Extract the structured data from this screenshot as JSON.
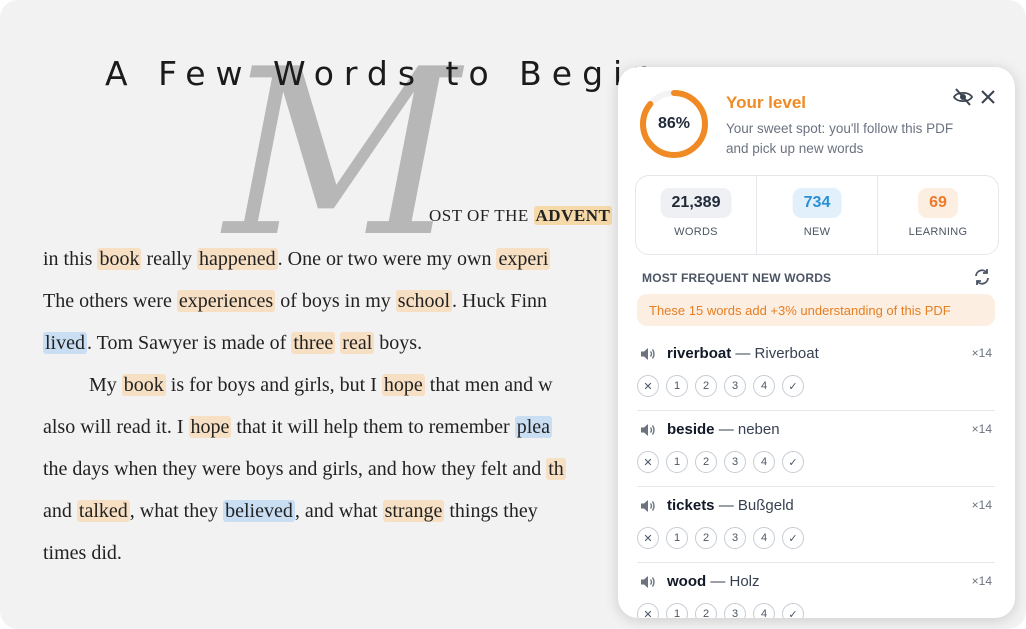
{
  "book": {
    "title": "A Few Words to Begin",
    "dropcap": "M",
    "lines": [
      [
        {
          "t": "OST OF THE ",
          "c": "caps"
        },
        {
          "t": "ADVENT",
          "c": "hl-strong caps"
        }
      ],
      [
        {
          "t": "in this "
        },
        {
          "t": "book",
          "c": "hl-o"
        },
        {
          "t": " really "
        },
        {
          "t": "happened",
          "c": "hl-o"
        },
        {
          "t": ". One or two were my own "
        },
        {
          "t": "experi",
          "c": "hl-o"
        }
      ],
      [
        {
          "t": "The others were "
        },
        {
          "t": "experiences",
          "c": "hl-o"
        },
        {
          "t": " of boys in my "
        },
        {
          "t": "school",
          "c": "hl-o"
        },
        {
          "t": ". Huck Finn"
        }
      ],
      [
        {
          "t": "lived",
          "c": "hl-b"
        },
        {
          "t": ". Tom Sawyer is made of "
        },
        {
          "t": "three",
          "c": "hl-o"
        },
        {
          "t": " "
        },
        {
          "t": "real",
          "c": "hl-o"
        },
        {
          "t": " boys."
        }
      ],
      [
        {
          "t": "My "
        },
        {
          "t": "book",
          "c": "hl-o"
        },
        {
          "t": " is for boys and girls, but I "
        },
        {
          "t": "hope",
          "c": "hl-o"
        },
        {
          "t": " that men and w"
        }
      ],
      [
        {
          "t": "also will read it. I "
        },
        {
          "t": "hope",
          "c": "hl-o"
        },
        {
          "t": " that it will help them to remember "
        },
        {
          "t": "plea",
          "c": "hl-b"
        }
      ],
      [
        {
          "t": "the days when they were boys and girls, and how they felt and "
        },
        {
          "t": "th",
          "c": "hl-o"
        }
      ],
      [
        {
          "t": "and "
        },
        {
          "t": "talked",
          "c": "hl-o"
        },
        {
          "t": ", what they "
        },
        {
          "t": "believed",
          "c": "hl-b"
        },
        {
          "t": ", and what "
        },
        {
          "t": "strange",
          "c": "hl-o"
        },
        {
          "t": " things they"
        }
      ],
      [
        {
          "t": "times did."
        }
      ]
    ]
  },
  "panel": {
    "level_percent": 86,
    "level_label": "86%",
    "level_title": "Your level",
    "level_desc": "Your sweet spot: you'll follow this PDF and pick up new words",
    "stats": [
      {
        "value": "21,389",
        "label": "WORDS",
        "bg": "#eef0f3",
        "color": "#1f2937"
      },
      {
        "value": "734",
        "label": "NEW",
        "bg": "#e1f0fb",
        "color": "#2b8fd6"
      },
      {
        "value": "69",
        "label": "LEARNING",
        "bg": "#fdeee2",
        "color": "#ee7a2a"
      }
    ],
    "section_title": "MOST FREQUENT NEW WORDS",
    "banner": "These 15 words add +3% understanding of this PDF",
    "words": [
      {
        "word": "riverboat",
        "translation": "Riverboat",
        "count": "×14"
      },
      {
        "word": "beside",
        "translation": "neben",
        "count": "×14"
      },
      {
        "word": "tickets",
        "translation": "Bußgeld",
        "count": "×14"
      },
      {
        "word": "wood",
        "translation": "Holz",
        "count": "×14"
      }
    ],
    "rating_labels": [
      "✕",
      "1",
      "2",
      "3",
      "4",
      "✓"
    ],
    "colors": {
      "accent": "#f08a24",
      "ring_track": "#f3f3f3"
    }
  }
}
